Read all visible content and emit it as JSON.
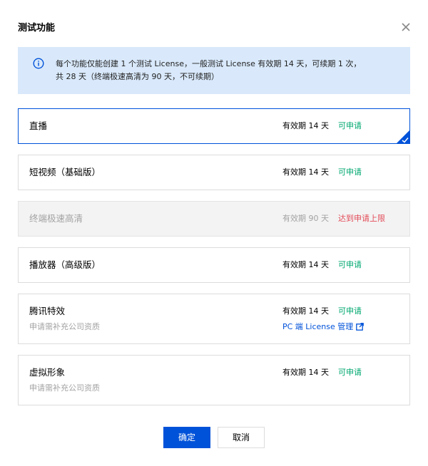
{
  "dialog": {
    "title": "测试功能",
    "close_icon": "close-icon"
  },
  "notice": {
    "icon": "info-circle-icon",
    "line1": "每个功能仅能创建 1 个测试 License，一般测试 License 有效期 14 天，可续期 1 次，",
    "line2": "共 28 天（终端极速高清为 90 天，不可续期）"
  },
  "items": [
    {
      "name": "直播",
      "valid": "有效期 14 天",
      "status": "可申请",
      "state": "selected"
    },
    {
      "name": "短视频（基础版）",
      "valid": "有效期 14 天",
      "status": "可申请",
      "state": "normal"
    },
    {
      "name": "终端极速高清",
      "valid": "有效期 90 天",
      "status": "达到申请上限",
      "state": "disabled"
    },
    {
      "name": "播放器（高级版）",
      "valid": "有效期 14 天",
      "status": "可申请",
      "state": "normal"
    },
    {
      "name": "腾讯特效",
      "sub": "申请需补充公司资质",
      "valid": "有效期 14 天",
      "status": "可申请",
      "link": "PC 端 License 管理",
      "state": "normal"
    },
    {
      "name": "虚拟形象",
      "sub": "申请需补充公司资质",
      "valid": "有效期 14 天",
      "status": "可申请",
      "state": "normal"
    }
  ],
  "colors": {
    "primary": "#0052d9",
    "success": "#00a870",
    "danger": "#e34d59",
    "notice_bg": "#d9e9fb"
  },
  "footer": {
    "confirm_label": "确定",
    "cancel_label": "取消"
  }
}
